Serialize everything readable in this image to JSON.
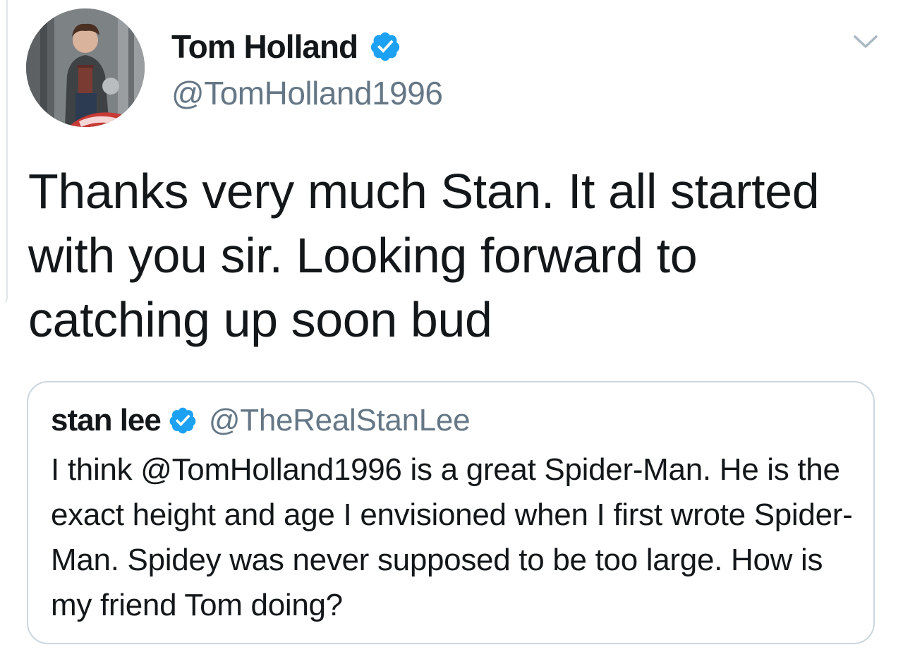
{
  "tweet": {
    "author": {
      "display_name": "Tom Holland",
      "handle": "@TomHolland1996",
      "verified_icon": "verified-badge-icon",
      "avatar": "profile-photo"
    },
    "menu_icon": "chevron-down-icon",
    "text": "Thanks very much Stan. It all started with you sir. Looking forward to catching up soon bud",
    "quoted_tweet": {
      "author": {
        "display_name": "stan lee",
        "handle": "@TheRealStanLee",
        "verified_icon": "verified-badge-icon"
      },
      "text": "I think @TomHolland1996 is a great Spider-Man. He is the exact height and age I envisioned when I first wrote Spider-Man. Spidey was never supposed to be too large. How is my friend Tom doing?"
    }
  },
  "colors": {
    "primary_text": "#14171a",
    "secondary_text": "#657786",
    "verified_blue": "#1da1f2",
    "card_border": "#ccd6dd"
  }
}
